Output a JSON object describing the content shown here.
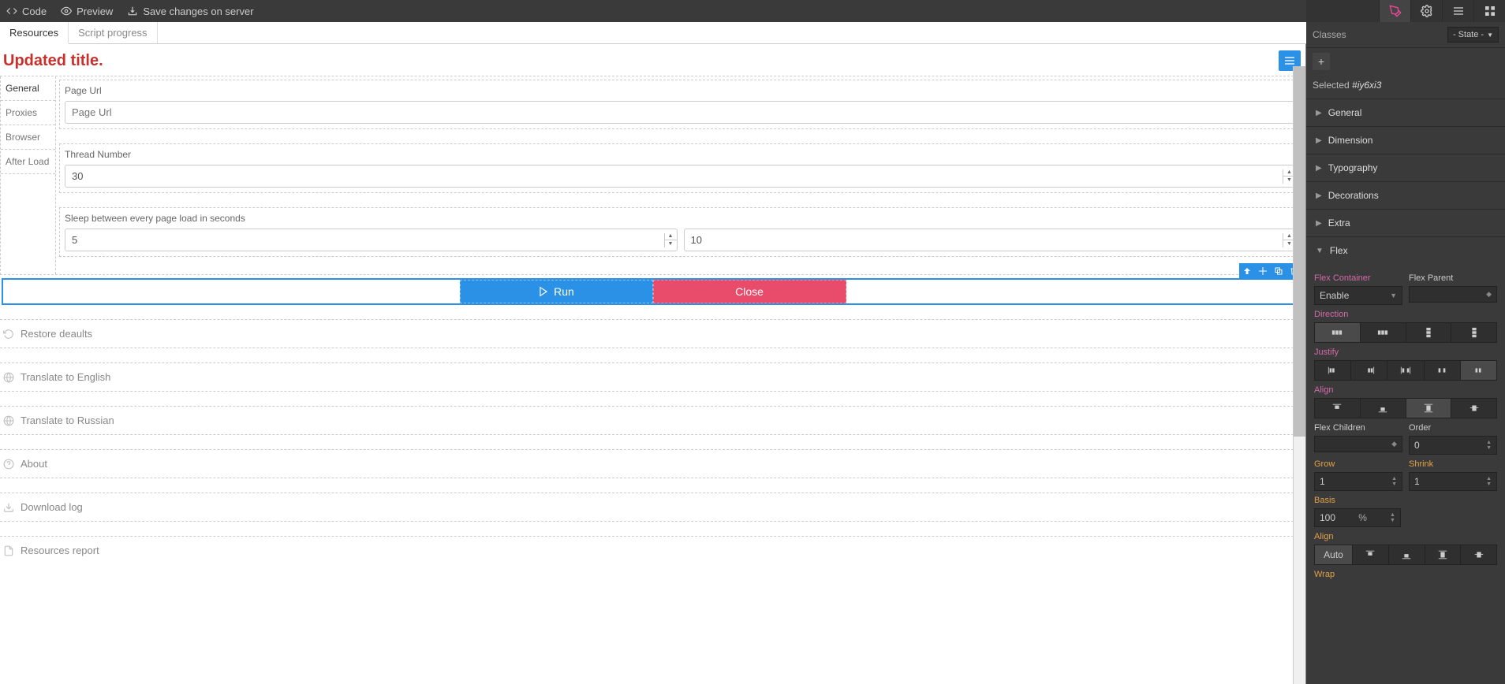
{
  "topbar": {
    "code": "Code",
    "preview": "Preview",
    "save": "Save changes on server"
  },
  "tabs": [
    "Resources",
    "Script progress"
  ],
  "page": {
    "title": "Updated title."
  },
  "sideTabs": [
    "General",
    "Proxies",
    "Browser",
    "After Load"
  ],
  "fields": {
    "pageUrl": {
      "label": "Page Url",
      "placeholder": "Page Url",
      "value": ""
    },
    "threads": {
      "label": "Thread Number",
      "value": "30"
    },
    "sleep": {
      "label": "Sleep between every page load in seconds",
      "from": "5",
      "to": "10"
    }
  },
  "buttons": {
    "run": "Run",
    "close": "Close"
  },
  "links": {
    "restore": "Restore deaults",
    "en": "Translate to English",
    "ru": "Translate to Russian",
    "about": "About",
    "dl": "Download log",
    "rep": "Resources report"
  },
  "panel": {
    "classes": "Classes",
    "state": "- State -",
    "selected": "Selected",
    "selId": "#iy6xi3",
    "sections": [
      "General",
      "Dimension",
      "Typography",
      "Decorations",
      "Extra",
      "Flex"
    ],
    "flex": {
      "container": "Flex Container",
      "parent": "Flex Parent",
      "enable": "Enable",
      "direction": "Direction",
      "justify": "Justify",
      "align": "Align",
      "children": "Flex Children",
      "order": "Order",
      "orderVal": "0",
      "grow": "Grow",
      "growVal": "1",
      "shrink": "Shrink",
      "shrinkVal": "1",
      "basis": "Basis",
      "basisVal": "100",
      "basisUnit": "%",
      "align2": "Align",
      "auto": "Auto",
      "wrap": "Wrap"
    }
  }
}
